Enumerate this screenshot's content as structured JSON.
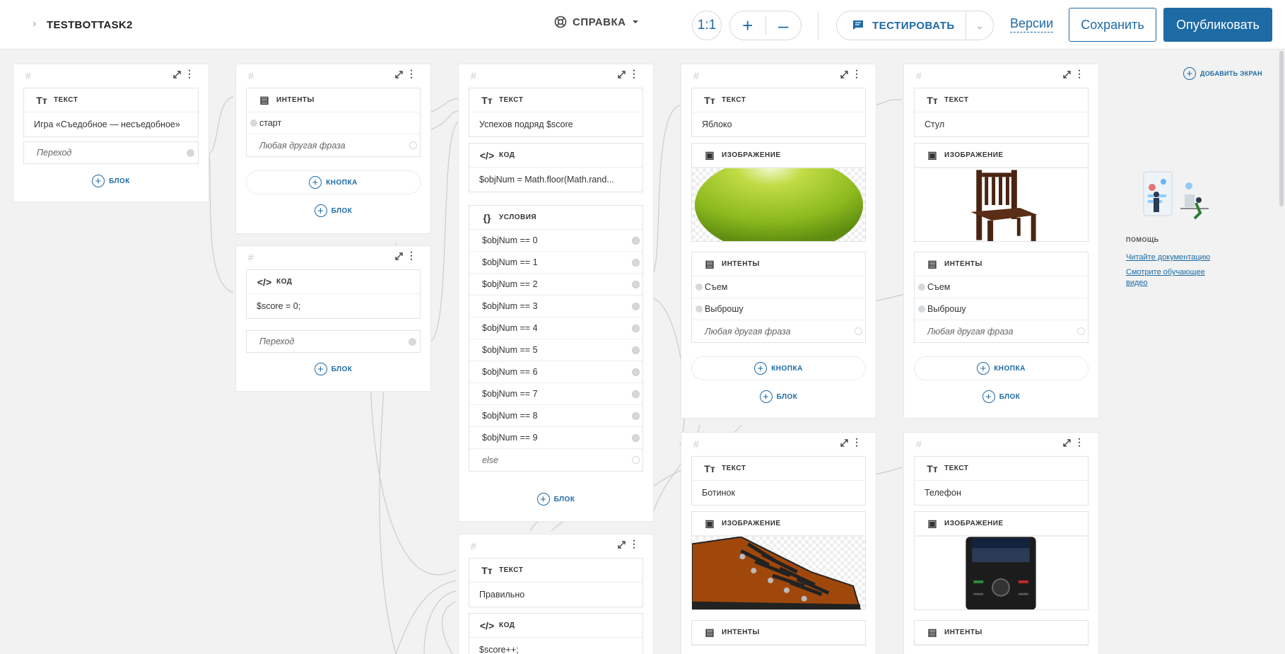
{
  "header": {
    "bot_name": "TESTBOTTASK2",
    "help_label": "СПРАВКА",
    "zoom_reset": "1:1",
    "zoom_in": "+",
    "zoom_out": "–",
    "test_label": "ТЕСТИРОВАТЬ",
    "versions_label": "Версии",
    "save_label": "Сохранить",
    "publish_label": "Опубликовать"
  },
  "common": {
    "hash": "#",
    "block_type_text": "ТЕКСТ",
    "block_type_intents": "ИНТЕНТЫ",
    "block_type_code": "КОД",
    "block_type_conditions": "УСЛОВИЯ",
    "block_type_image": "ИЗОБРАЖЕНИЕ",
    "add_block": "БЛОК",
    "add_button": "КНОПКА",
    "transition": "Переход",
    "any_phrase": "Любая другая фраза"
  },
  "screens": {
    "s1": {
      "text": "Игра «Съедобное — несъедобное»"
    },
    "s2": {
      "intent1": "старт"
    },
    "s3": {
      "code": "$score = 0;"
    },
    "s4": {
      "text": "Успехов подряд $score",
      "code": "$objNum = Math.floor(Math.rand...",
      "conditions": [
        "$objNum == 0",
        "$objNum == 1",
        "$objNum == 2",
        "$objNum == 3",
        "$objNum == 4",
        "$objNum == 5",
        "$objNum == 6",
        "$objNum == 7",
        "$objNum == 8",
        "$objNum == 9"
      ],
      "else": "else"
    },
    "s5": {
      "text": "Правильно",
      "code": "$score++;"
    },
    "s6": {
      "text": "Яблоко",
      "intent1": "Съем",
      "intent2": "Выброшу"
    },
    "s7": {
      "text": "Стул",
      "intent1": "Съем",
      "intent2": "Выброшу"
    },
    "s8": {
      "text": "Ботинок"
    },
    "s9": {
      "text": "Телефон"
    }
  },
  "sidebar": {
    "add_screen": "ДОБАВИТЬ ЭКРАН",
    "help_title": "ПОМОЩЬ",
    "read_docs": "Читайте документацию",
    "watch_video_1": "Смотрите обучающее",
    "watch_video_2": "видео"
  },
  "colors": {
    "accent": "#1d6aa5",
    "canvas": "#f1f2f1"
  }
}
